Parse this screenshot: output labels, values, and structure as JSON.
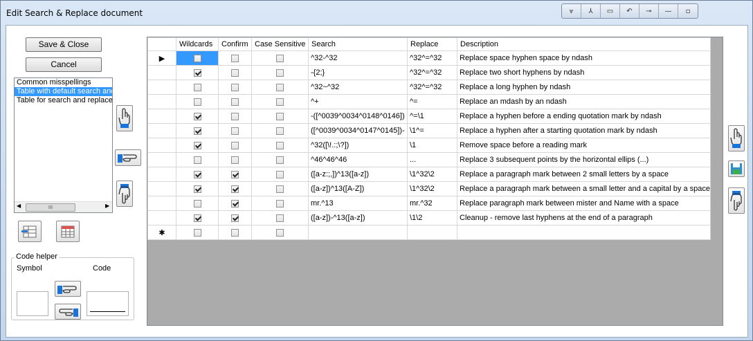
{
  "window": {
    "title": "Edit Search & Replace document"
  },
  "caption_buttons": [
    "⩔",
    "⅄",
    "▭",
    "↶",
    "⊸",
    "—",
    "▫"
  ],
  "buttons": {
    "save_close": "Save & Close",
    "cancel": "Cancel"
  },
  "list": {
    "items": [
      {
        "label": "Common misspellings",
        "selected": false
      },
      {
        "label": "Table with default search and replace",
        "selected": true
      },
      {
        "label": "Table for search and replace",
        "selected": false
      }
    ],
    "scroll_grip": "III"
  },
  "code_helper": {
    "title": "Code helper",
    "symbol_label": "Symbol",
    "code_label": "Code"
  },
  "grid": {
    "columns": [
      "Wildcards",
      "Confirm",
      "Case Sensitive",
      "Search",
      "Replace",
      "Description"
    ],
    "current_row_marker": "▶",
    "new_row_marker": "✱",
    "rows": [
      {
        "wildcards": false,
        "confirm": false,
        "case": false,
        "search": "^32-^32",
        "replace": "^32^=^32",
        "description": "Replace space hyphen space by ndash"
      },
      {
        "wildcards": true,
        "confirm": false,
        "case": false,
        "search": "-{2;}",
        "replace": "^32^=^32",
        "description": "Replace two short hyphens by ndash"
      },
      {
        "wildcards": false,
        "confirm": false,
        "case": false,
        "search": "^32~^32",
        "replace": "^32^=^32",
        "description": "Replace a long hyphen by ndash"
      },
      {
        "wildcards": false,
        "confirm": false,
        "case": false,
        "search": "^+",
        "replace": "^=",
        "description": "Replace an mdash by an ndash"
      },
      {
        "wildcards": true,
        "confirm": false,
        "case": false,
        "search": "-([^0039^0034^0148^0146])",
        "replace": "^=\\1",
        "description": "Replace a hyphen before a ending quotation mark by ndash"
      },
      {
        "wildcards": true,
        "confirm": false,
        "case": false,
        "search": "([^0039^0034^0147^0145])-",
        "replace": "\\1^=",
        "description": "Replace a hyphen after a starting quotation mark by ndash"
      },
      {
        "wildcards": true,
        "confirm": false,
        "case": false,
        "search": "^32([\\!.:;\\?])",
        "replace": "\\1",
        "description": "Remove space before a reading mark"
      },
      {
        "wildcards": false,
        "confirm": false,
        "case": false,
        "search": "^46^46^46",
        "replace": "...",
        "description": "Replace 3 subsequent points by the horizontal ellips (...)"
      },
      {
        "wildcards": true,
        "confirm": true,
        "case": false,
        "search": "([a-z:;,])^13([a-z])",
        "replace": "\\1^32\\2",
        "description": "Replace a paragraph mark between 2 small letters by a space"
      },
      {
        "wildcards": true,
        "confirm": true,
        "case": false,
        "search": "([a-z])^13([A-Z])",
        "replace": "\\1^32\\2",
        "description": "Replace a paragraph mark between a small letter and a capital by a space"
      },
      {
        "wildcards": false,
        "confirm": true,
        "case": false,
        "search": "mr.^13",
        "replace": "mr.^32",
        "description": "Replace paragraph mark between mister and Name with a space"
      },
      {
        "wildcards": true,
        "confirm": true,
        "case": false,
        "search": "([a-z])-^13([a-z])",
        "replace": "\\1\\2",
        "description": "Cleanup - remove last hyphens at the end of a paragraph"
      }
    ]
  }
}
